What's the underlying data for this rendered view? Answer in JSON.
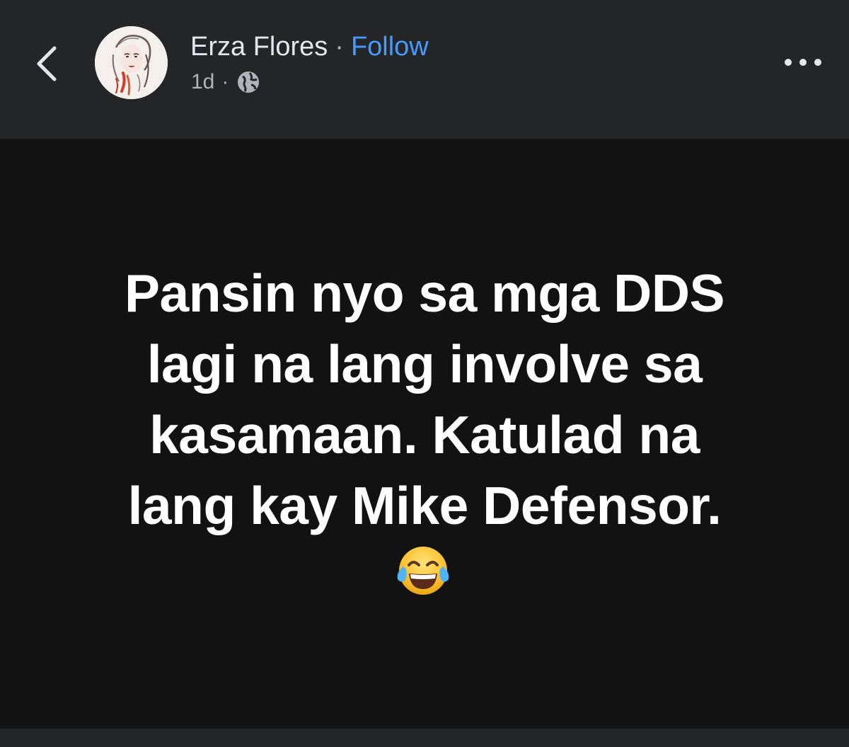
{
  "header": {
    "author_name": "Erza Flores",
    "separator": "·",
    "follow_label": "Follow",
    "timestamp": "1d",
    "meta_separator": "·",
    "audience_icon": "globe-icon",
    "back_icon": "chevron-left-icon",
    "more_icon": "more-horizontal-icon"
  },
  "post": {
    "lines": [
      "Pansin nyo sa mga DDS",
      "lagi na lang involve sa",
      "kasamaan. Katulad na",
      "lang kay Mike Defensor."
    ],
    "emoji": "face-with-tears-of-joy-emoji"
  },
  "colors": {
    "header_bg": "#242527",
    "post_bg": "#121212",
    "link": "#4599ff",
    "text_primary": "#e4e6eb",
    "text_secondary": "#b0b3b8"
  }
}
